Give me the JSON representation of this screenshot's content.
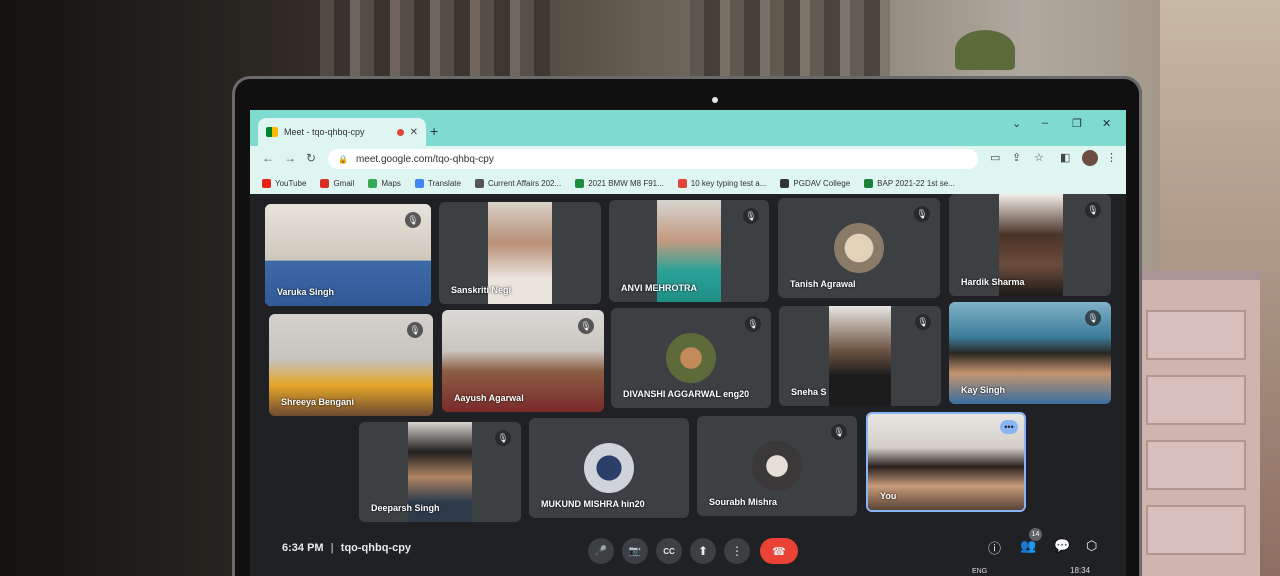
{
  "browser": {
    "tab_title": "Meet - tqo-qhbq-cpy",
    "url": "meet.google.com/tqo-qhbq-cpy",
    "bookmarks": [
      {
        "label": "YouTube",
        "color": "#e62117"
      },
      {
        "label": "Gmail",
        "color": "#d93025"
      },
      {
        "label": "Maps",
        "color": "#34a853"
      },
      {
        "label": "Translate",
        "color": "#4285f4"
      },
      {
        "label": "Current Affairs 202...",
        "color": "#555555"
      },
      {
        "label": "2021 BMW M8 F91...",
        "color": "#1e8e3e"
      },
      {
        "label": "10 key typing test a...",
        "color": "#e0443a"
      },
      {
        "label": "PGDAV College",
        "color": "#333333"
      },
      {
        "label": "BAP 2021-22 1st se...",
        "color": "#188038"
      }
    ]
  },
  "participants": [
    {
      "name": "Varuka Singh",
      "muted": true
    },
    {
      "name": "Sanskriti Negi",
      "muted": false
    },
    {
      "name": "ANVI MEHROTRA",
      "muted": true
    },
    {
      "name": "Tanish Agrawal",
      "muted": true
    },
    {
      "name": "Hardik Sharma",
      "muted": true
    },
    {
      "name": "Shreeya Bengani",
      "muted": true
    },
    {
      "name": "Aayush Agarwal",
      "muted": true
    },
    {
      "name": "DIVANSHI AGGARWAL eng20",
      "muted": true
    },
    {
      "name": "Sneha S",
      "muted": true
    },
    {
      "name": "Kay Singh",
      "muted": true
    },
    {
      "name": "Deeparsh Singh",
      "muted": true
    },
    {
      "name": "MUKUND MISHRA hin20",
      "muted": false
    },
    {
      "name": "Sourabh Mishra",
      "muted": true
    },
    {
      "name": "You",
      "muted": false
    }
  ],
  "meeting": {
    "time": "6:34 PM",
    "separator": "|",
    "code": "tqo-qhbq-cpy",
    "participant_count": "14"
  },
  "taskbar": {
    "lang": "ENG",
    "time": "18:34"
  },
  "icons": {
    "mute": "🎙",
    "mic": "🎤",
    "camera": "📷",
    "captions": "CC",
    "present": "⬆",
    "more": "⋮",
    "end_call": "☎",
    "info": "ⓘ",
    "people": "👥",
    "chat": "💬",
    "activities": "⬡"
  }
}
